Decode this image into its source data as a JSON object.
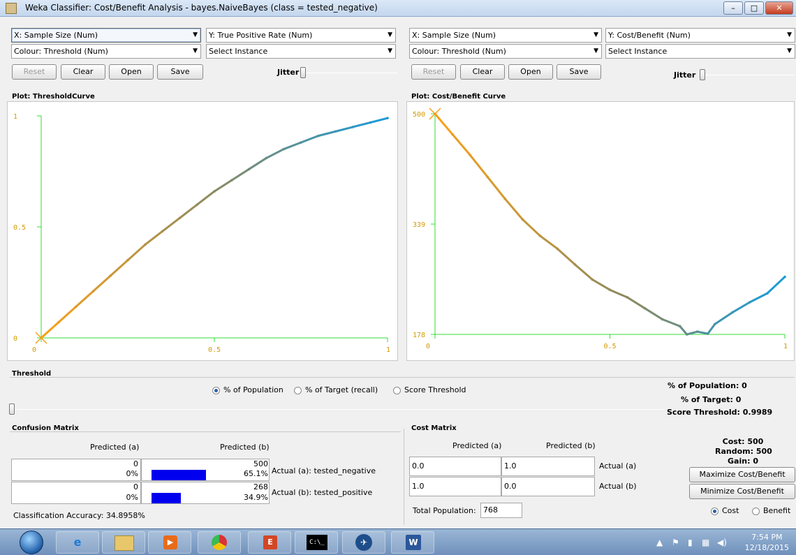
{
  "window": {
    "title": "Weka Classifier: Cost/Benefit Analysis - bayes.NaiveBayes  (class = tested_negative)",
    "controls": {
      "minimize": "–",
      "maximize": "□",
      "close": "✕"
    }
  },
  "left": {
    "x_combo": "X: Sample Size (Num)",
    "y_combo": "Y: True Positive Rate (Num)",
    "colour_combo": "Colour: Threshold (Num)",
    "instance_combo": "Select Instance",
    "buttons": {
      "reset": "Reset",
      "clear": "Clear",
      "open": "Open",
      "save": "Save"
    },
    "jitter_label": "Jitter",
    "plot_title": "Plot: ThresholdCurve"
  },
  "right": {
    "x_combo": "X: Sample Size (Num)",
    "y_combo": "Y: Cost/Benefit (Num)",
    "colour_combo": "Colour: Threshold (Num)",
    "instance_combo": "Select Instance",
    "buttons": {
      "reset": "Reset",
      "clear": "Clear",
      "open": "Open",
      "save": "Save"
    },
    "jitter_label": "Jitter",
    "plot_title": "Plot: Cost/Benefit Curve"
  },
  "chart_data": [
    {
      "type": "line",
      "title": "Plot: ThresholdCurve",
      "xlim": [
        0,
        1
      ],
      "ylim": [
        0,
        1
      ],
      "x_ticks": [
        "0",
        "0.5",
        "1"
      ],
      "y_ticks": [
        "0",
        "0.5",
        "1"
      ],
      "series": [
        {
          "x": [
            0,
            0.05,
            0.1,
            0.15,
            0.2,
            0.25,
            0.3,
            0.35,
            0.4,
            0.45,
            0.5,
            0.55,
            0.6,
            0.65,
            0.7,
            0.75,
            0.8,
            0.85,
            0.9,
            0.95,
            1.0
          ],
          "values": [
            0,
            0.07,
            0.14,
            0.21,
            0.28,
            0.35,
            0.42,
            0.48,
            0.54,
            0.6,
            0.66,
            0.71,
            0.76,
            0.81,
            0.85,
            0.88,
            0.91,
            0.93,
            0.95,
            0.97,
            0.99
          ]
        }
      ],
      "color_by": "Threshold",
      "colors": {
        "low": "#f5a01a",
        "mid": "#8a8a60",
        "high": "#1e9ad6"
      },
      "marker_colors": {
        "axes": "#33dd33",
        "cross": "#f5a01a",
        "ticks": "#d39a00"
      }
    },
    {
      "type": "line",
      "title": "Plot: Cost/Benefit Curve",
      "xlim": [
        0,
        1
      ],
      "ylim": [
        178,
        500
      ],
      "x_ticks": [
        "0",
        "0.5",
        "1"
      ],
      "y_ticks": [
        "178",
        "339",
        "500"
      ],
      "series": [
        {
          "x": [
            0,
            0.05,
            0.1,
            0.15,
            0.2,
            0.25,
            0.3,
            0.35,
            0.4,
            0.45,
            0.5,
            0.55,
            0.6,
            0.65,
            0.7,
            0.72,
            0.75,
            0.78,
            0.8,
            0.85,
            0.9,
            0.95,
            1.0
          ],
          "values": [
            500,
            470,
            440,
            408,
            376,
            346,
            322,
            303,
            280,
            258,
            243,
            232,
            216,
            200,
            190,
            178,
            182,
            179,
            193,
            210,
            225,
            238,
            262
          ]
        }
      ],
      "color_by": "Threshold",
      "colors": {
        "low": "#f5a01a",
        "mid": "#8a8a60",
        "high": "#1e9ad6"
      },
      "marker_colors": {
        "axes": "#33dd33",
        "cross": "#f5a01a",
        "ticks": "#d39a00"
      }
    }
  ],
  "threshold": {
    "section_label": "Threshold",
    "options": [
      "% of Population",
      "% of Target (recall)",
      "Score Threshold"
    ],
    "selected_index": 0,
    "slider_value": 0,
    "stats": {
      "population": "% of Population: 0",
      "target": "% of Target: 0",
      "score": "Score Threshold: 0.9989"
    }
  },
  "confusion": {
    "section_label": "Confusion Matrix",
    "col_a": "Predicted (a)",
    "col_b": "Predicted (b)",
    "rows": [
      {
        "a_count": "0",
        "a_pct": "0%",
        "b_count": "500",
        "b_pct": "65.1%",
        "b_fraction": 0.651,
        "label": "Actual (a): tested_negative"
      },
      {
        "a_count": "0",
        "a_pct": "0%",
        "b_count": "268",
        "b_pct": "34.9%",
        "b_fraction": 0.349,
        "label": "Actual (b): tested_positive"
      }
    ],
    "accuracy": "Classification Accuracy:  34.8958%"
  },
  "cost_matrix": {
    "section_label": "Cost Matrix",
    "col_a": "Predicted (a)",
    "col_b": "Predicted (b)",
    "rows": [
      {
        "a": "0.0",
        "b": "1.0",
        "label": "Actual (a)"
      },
      {
        "a": "1.0",
        "b": "0.0",
        "label": "Actual (b)"
      }
    ],
    "total_label": "Total Population:",
    "total_value": "768",
    "summary": {
      "cost": "Cost: 500",
      "random": "Random: 500",
      "gain": "Gain: 0"
    },
    "maximize_label": "Maximize Cost/Benefit",
    "minimize_label": "Minimize Cost/Benefit",
    "mode_cost": "Cost",
    "mode_benefit": "Benefit"
  },
  "taskbar": {
    "apps": [
      "start-orb",
      "internet-explorer",
      "file-explorer",
      "media-player",
      "chrome",
      "powerpoint-like",
      "command-prompt",
      "weka",
      "word"
    ],
    "cmd_label": "C:\\_",
    "clock_time": "7:54 PM",
    "clock_date": "12/18/2015"
  }
}
